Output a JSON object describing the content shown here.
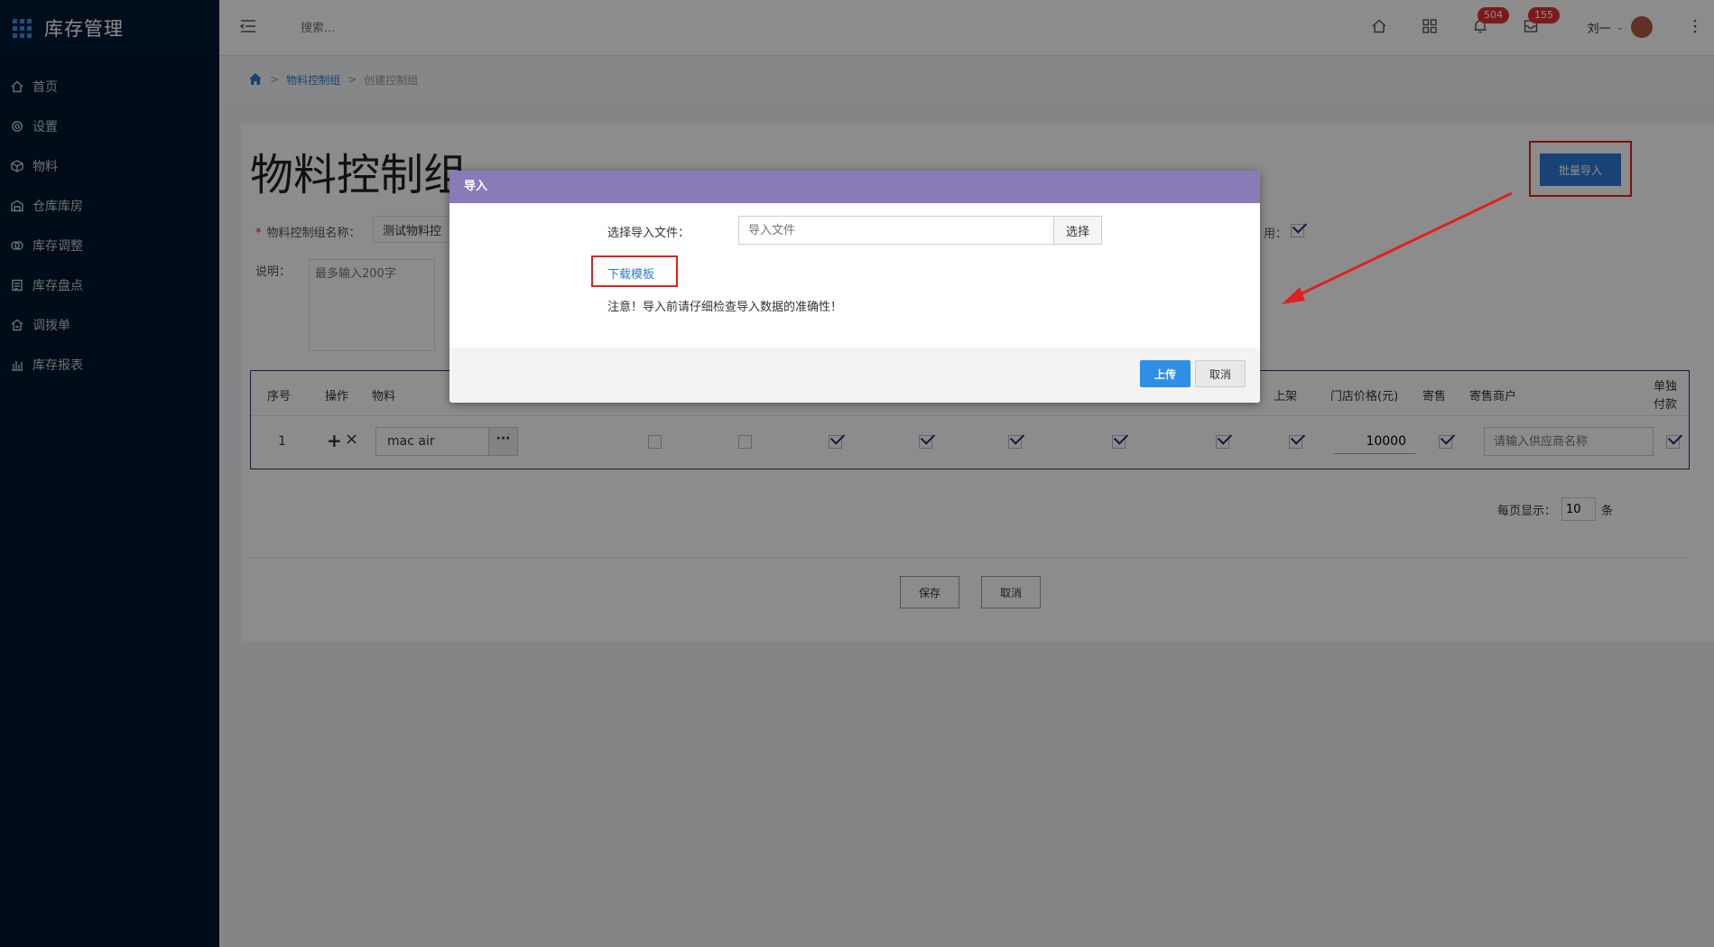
{
  "app": {
    "title": "库存管理"
  },
  "sidebar": {
    "items": [
      {
        "label": "首页",
        "icon": "home-icon"
      },
      {
        "label": "设置",
        "icon": "gear-icon"
      },
      {
        "label": "物料",
        "icon": "box-icon"
      },
      {
        "label": "仓库库房",
        "icon": "warehouse-icon"
      },
      {
        "label": "库存调整",
        "icon": "adjust-icon"
      },
      {
        "label": "库存盘点",
        "icon": "checklist-icon"
      },
      {
        "label": "调拨单",
        "icon": "transfer-icon"
      },
      {
        "label": "库存报表",
        "icon": "chart-icon"
      }
    ]
  },
  "topbar": {
    "search_placeholder": "搜索...",
    "notifications_count": "504",
    "messages_count": "155",
    "user_name": "刘一"
  },
  "breadcrumb": {
    "level1": "物料控制组",
    "level2": "创建控制组"
  },
  "page": {
    "title": "物料控制组",
    "bulk_import_label": "批量导入",
    "name_label": "物料控制组名称：",
    "name_value": "测试物料控",
    "desc_label": "说明：",
    "desc_placeholder": "最多输入200字",
    "enable_label": "用："
  },
  "table": {
    "headers": {
      "seq": "序号",
      "ops": "操作",
      "material": "物料",
      "shelf": "上架",
      "store_price": "门店价格(元)",
      "consign": "寄售",
      "consign_merchant": "寄售商户",
      "separate_pay_1": "单独",
      "separate_pay_2": "付款"
    },
    "rows": [
      {
        "seq": "1",
        "material": "mac  air",
        "price": "10000",
        "supplier_placeholder": "请输入供应商名称"
      }
    ]
  },
  "pager": {
    "label": "每页显示：",
    "value": "10",
    "unit": "条"
  },
  "footer": {
    "save_label": "保存",
    "cancel_label": "取消"
  },
  "dialog": {
    "title": "导入",
    "file_label": "选择导入文件：",
    "file_placeholder": "导入文件",
    "choose_label": "选择",
    "template_link": "下载模板",
    "note": "注意！导入前请仔细检查导入数据的准确性！",
    "upload_label": "上传",
    "cancel_label": "取消"
  },
  "colors": {
    "sidebar_bg": "#00162b",
    "primary": "#2f7bd6",
    "dialog_header": "#8a7ab8",
    "annotation_red": "#e02020",
    "badge_red": "#e1302f"
  }
}
